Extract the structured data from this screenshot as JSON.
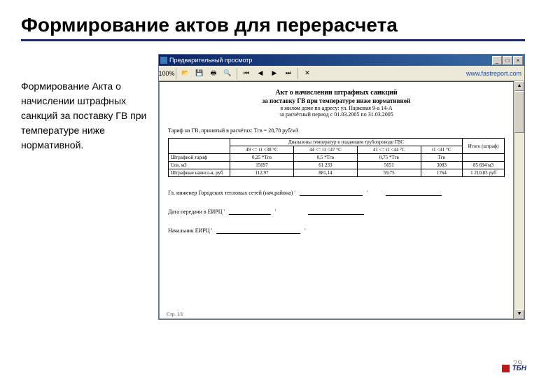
{
  "slide": {
    "title": "Формирование актов для перерасчета"
  },
  "sidebar": {
    "text": "Формирование Акта о начислении штрафных санкций за поставку ГВ при температуре ниже нормативной."
  },
  "preview_window": {
    "caption": "Предварительный просмотр",
    "toolbar": {
      "zoom": "100%",
      "link_text": "www.fastreport.com"
    },
    "doc": {
      "h3": "Акт о начислении штрафных санкций",
      "h4": "за поставку ГВ при температуре ниже нормативной",
      "line1": "в жилом доме по адресу: ул. Парковая 9-а 14-А",
      "line2": "за расчётный период с 01.03.2005 по 31.03.2005",
      "tariff": "Тариф на ГВ, принятый в расчётах: Тгв = 28,78 руб/м3",
      "table": {
        "group_header": "Диапазоны температур в подающем трубопроводе ГВС",
        "itogo_header": "Итого (штраф)",
        "col_ranges": [
          "49 <= t1 <38 °C",
          "44 <= t1 <47 °C",
          "41 <= t1 <44 °C",
          "t1 <41 °C"
        ],
        "rows": [
          {
            "label": "Штрафной тариф",
            "c": [
              "0,25 *Тгв",
              "0,5 *Тгв",
              "0,75 *Тгв",
              "Тгв"
            ],
            "itogo": ""
          },
          {
            "label": "Uгв, м3",
            "c": [
              "15697",
              "61 233",
              "5651",
              "3083"
            ],
            "itogo": "85 694 м3"
          },
          {
            "label": "Штрафные начисл-я, руб",
            "c": [
              "112,97",
              "881,14",
              "59,75",
              "1764"
            ],
            "itogo": "1 210,83 руб"
          }
        ]
      },
      "sig1_label": "Гл. инженер Городских тепловых сетей (нач.района) '",
      "sig2_label": "Дата передачи в ЕИРЦ '",
      "sig3_label": "Начальник ЕИРЦ '",
      "footer": "Стр. 1/1"
    }
  },
  "page_number": "29",
  "brand": "ТБН"
}
